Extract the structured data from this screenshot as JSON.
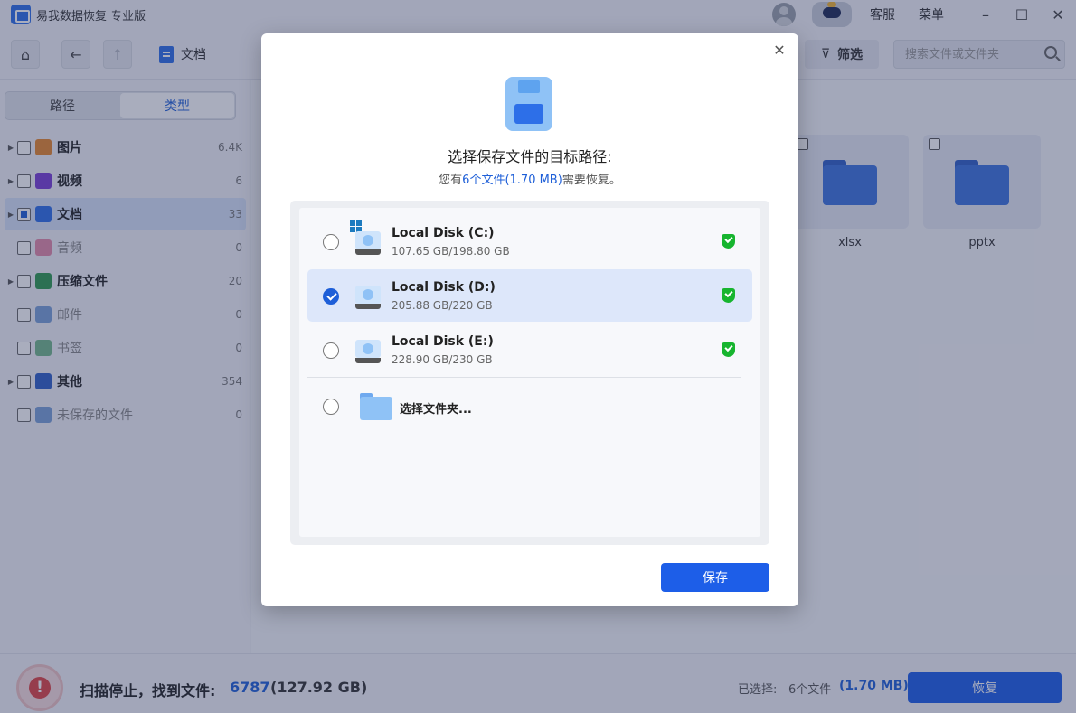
{
  "app": {
    "title": "易我数据恢复 专业版",
    "service_label": "客服",
    "menu_label": "菜单"
  },
  "toolbar": {
    "breadcrumb": "文档",
    "filter_label": "筛选",
    "search_placeholder": "搜索文件或文件夹"
  },
  "sidebar": {
    "tabs": [
      {
        "label": "路径"
      },
      {
        "label": "类型"
      }
    ],
    "categories": [
      {
        "label": "图片",
        "count": "6.4K",
        "color": "#e8872c"
      },
      {
        "label": "视频",
        "count": "6",
        "color": "#7b3fd6"
      },
      {
        "label": "文档",
        "count": "33",
        "color": "#2d6fe8"
      },
      {
        "label": "音频",
        "count": "0",
        "color": "#e58aa8"
      },
      {
        "label": "压缩文件",
        "count": "20",
        "color": "#2f9a4f"
      },
      {
        "label": "邮件",
        "count": "0",
        "color": "#7aa0d8"
      },
      {
        "label": "书签",
        "count": "0",
        "color": "#73b88a"
      },
      {
        "label": "其他",
        "count": "354",
        "color": "#2f5fc7"
      },
      {
        "label": "未保存的文件",
        "count": "0",
        "color": "#7aa0d8"
      }
    ]
  },
  "main": {
    "tiles": [
      {
        "label": "xlsx"
      },
      {
        "label": "pptx"
      }
    ]
  },
  "status": {
    "scan_text": "扫描停止，找到文件:",
    "found_count": "6787",
    "found_size": "(127.92 GB)",
    "selected_label": "已选择:",
    "selected_count": "6个文件",
    "selected_size": "(1.70 MB)",
    "recover_label": "恢复"
  },
  "dialog": {
    "title": "选择保存文件的目标路径:",
    "subtitle_prefix": "您有",
    "subtitle_highlight": "6个文件(1.70 MB)",
    "subtitle_suffix": "需要恢复。",
    "drives": [
      {
        "name": "Local Disk (C:)",
        "size": "107.65 GB/198.80 GB"
      },
      {
        "name": "Local Disk (D:)",
        "size": "205.88 GB/220 GB"
      },
      {
        "name": "Local Disk (E:)",
        "size": "228.90 GB/230 GB"
      }
    ],
    "folder_option": "选择文件夹...",
    "save_label": "保存"
  },
  "colors": {
    "accent": "#1d5ee8",
    "safe_green": "#17b52f",
    "alert_red": "#e04545"
  }
}
